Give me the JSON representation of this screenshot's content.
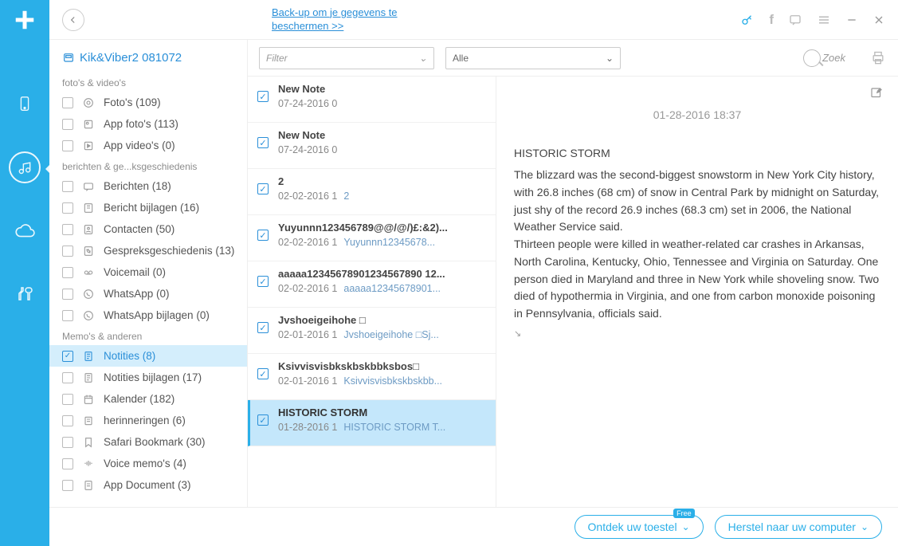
{
  "header": {
    "backup_link": "Back-up om je gegevens te beschermen >>",
    "search_placeholder": "Zoek"
  },
  "sidebar": {
    "title": "Kik&Viber2 081072",
    "groups": [
      {
        "label": "foto's & video's",
        "items": [
          {
            "label": "Foto's (109)",
            "icon": "gallery"
          },
          {
            "label": "App foto's (113)",
            "icon": "gallery2"
          },
          {
            "label": "App video's (0)",
            "icon": "video"
          }
        ]
      },
      {
        "label": "berichten & ge...ksgeschiedenis",
        "items": [
          {
            "label": "Berichten (18)",
            "icon": "msg"
          },
          {
            "label": "Bericht bijlagen (16)",
            "icon": "attach"
          },
          {
            "label": "Contacten (50)",
            "icon": "contact"
          },
          {
            "label": "Gespreksgeschiedenis (13)",
            "icon": "call"
          },
          {
            "label": "Voicemail (0)",
            "icon": "voicemail"
          },
          {
            "label": "WhatsApp (0)",
            "icon": "whatsapp"
          },
          {
            "label": "WhatsApp bijlagen (0)",
            "icon": "whatsapp"
          }
        ]
      },
      {
        "label": "Memo's & anderen",
        "items": [
          {
            "label": "Notities (8)",
            "icon": "note",
            "selected": true,
            "checked": true
          },
          {
            "label": "Notities bijlagen (17)",
            "icon": "note"
          },
          {
            "label": "Kalender (182)",
            "icon": "calendar"
          },
          {
            "label": "herinneringen (6)",
            "icon": "reminder"
          },
          {
            "label": "Safari Bookmark (30)",
            "icon": "bookmark"
          },
          {
            "label": "Voice memo's (4)",
            "icon": "voice"
          },
          {
            "label": "App Document (3)",
            "icon": "doc"
          }
        ]
      }
    ]
  },
  "filterbar": {
    "filter_label": "Filter",
    "all_label": "Alle"
  },
  "notes": [
    {
      "title": "New Note",
      "date": "07-24-2016 0",
      "preview": ""
    },
    {
      "title": "New Note",
      "date": "07-24-2016 0",
      "preview": ""
    },
    {
      "title": "2",
      "date": "02-02-2016 1",
      "preview": "2"
    },
    {
      "title": "Yuyunnn123456789@@/@/)£:&2)...",
      "date": "02-02-2016 1",
      "preview": "Yuyunnn12345678..."
    },
    {
      "title": "aaaaa12345678901234567890 12...",
      "date": "02-02-2016 1",
      "preview": "aaaaa12345678901..."
    },
    {
      "title": "Jvshoeigeihohe □",
      "date": "02-01-2016 1",
      "preview": "Jvshoeigeihohe □Sj..."
    },
    {
      "title": "Ksivvisvisbkskbskbbksbos□",
      "date": "02-01-2016 1",
      "preview": "Ksivvisvisbkskbskbb..."
    },
    {
      "title": "HISTORIC STORM",
      "date": "01-28-2016 1",
      "preview": "HISTORIC STORM T...",
      "selected": true
    }
  ],
  "detail": {
    "timestamp": "01-28-2016 18:37",
    "heading": "HISTORIC STORM",
    "para1": "The blizzard was the second-biggest snowstorm in New York City history, with 26.8 inches (68 cm) of snow in Central Park by midnight on Saturday, just shy of the record 26.9 inches (68.3 cm) set in 2006, the National Weather Service said.",
    "para2": "Thirteen people were killed in weather-related car crashes in Arkansas, North Carolina, Kentucky, Ohio, Tennessee and Virginia on Saturday. One person died in Maryland and three in New York while shoveling snow. Two died of hypothermia in Virginia, and one from carbon monoxide poisoning in Pennsylvania, officials said."
  },
  "footer": {
    "discover": "Ontdek uw toestel",
    "free_tag": "Free",
    "restore": "Herstel naar uw computer"
  }
}
